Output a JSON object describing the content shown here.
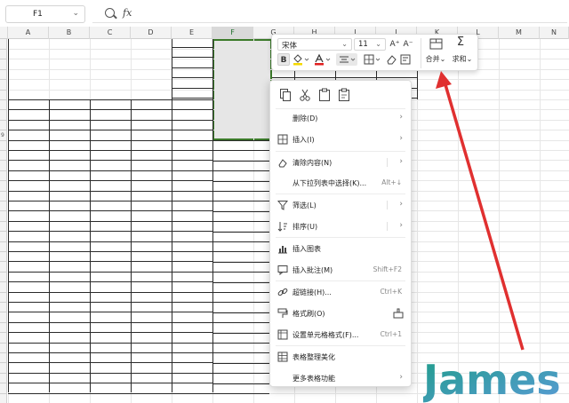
{
  "formula_bar": {
    "cell_ref": "F1",
    "fx": "fx"
  },
  "columns": [
    "A",
    "B",
    "C",
    "D",
    "E",
    "F",
    "G",
    "H",
    "I",
    "J",
    "K",
    "L",
    "M",
    "N"
  ],
  "selected_column": "F",
  "row_number": "9",
  "mini_toolbar": {
    "font_name": "宋体",
    "font_size": "11",
    "grow_font": "A⁺",
    "shrink_font": "A⁻",
    "bold": "B",
    "merge_label": "合并",
    "sum_label": "求和",
    "accent_red": "#e02020",
    "fill_yellow": "#f5d800"
  },
  "context_menu": {
    "items": [
      {
        "label": "删除(D)",
        "shortcut": "",
        "submenu": true
      },
      {
        "label": "插入(I)",
        "shortcut": "",
        "submenu": true
      },
      {
        "label": "清除内容(N)",
        "shortcut": "",
        "submenu": true
      },
      {
        "label": "从下拉列表中选择(K)...",
        "shortcut": "Alt+↓",
        "submenu": false
      },
      {
        "label": "筛选(L)",
        "shortcut": "",
        "submenu": true
      },
      {
        "label": "排序(U)",
        "shortcut": "",
        "submenu": true
      },
      {
        "label": "插入图表",
        "shortcut": "",
        "submenu": false
      },
      {
        "label": "插入批注(M)",
        "shortcut": "Shift+F2",
        "submenu": false
      },
      {
        "label": "超链接(H)...",
        "shortcut": "Ctrl+K",
        "submenu": false
      },
      {
        "label": "格式刷(O)",
        "shortcut": "",
        "submenu": false
      },
      {
        "label": "设置单元格格式(F)...",
        "shortcut": "Ctrl+1",
        "submenu": false
      },
      {
        "label": "表格整理美化",
        "shortcut": "",
        "submenu": false
      },
      {
        "label": "更多表格功能",
        "shortcut": "",
        "submenu": true
      }
    ]
  },
  "watermark": {
    "text": "James",
    "color_start": "#1f9d8a",
    "color_end": "#5a9bd6"
  },
  "arrow_color": "#e03030"
}
